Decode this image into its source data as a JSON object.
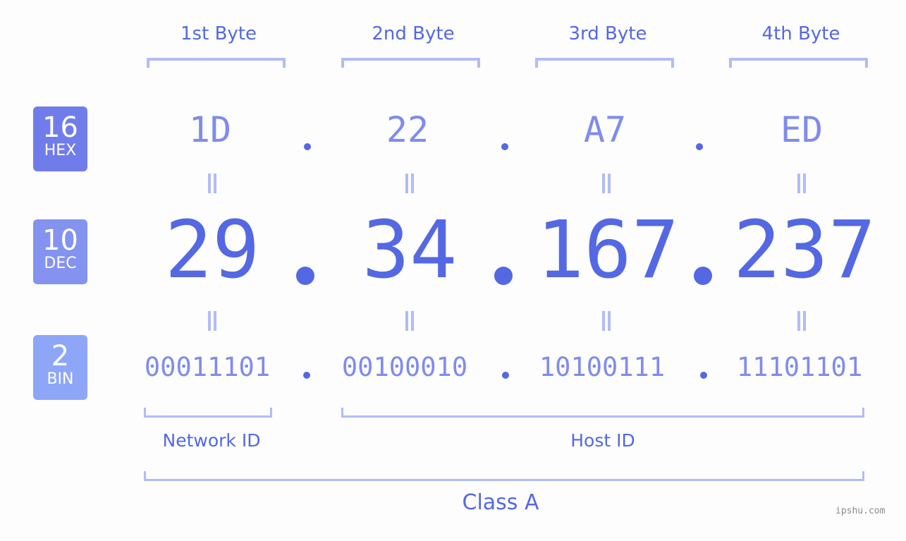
{
  "byte_headers": [
    "1st Byte",
    "2nd Byte",
    "3rd Byte",
    "4th Byte"
  ],
  "badges": {
    "hex": {
      "num": "16",
      "label": "HEX",
      "color": "#717ceb"
    },
    "dec": {
      "num": "10",
      "label": "DEC",
      "color": "#8492f0"
    },
    "bin": {
      "num": "2",
      "label": "BIN",
      "color": "#8ea6f7"
    }
  },
  "ip": {
    "hex": [
      "1D",
      "22",
      "A7",
      "ED"
    ],
    "dec": [
      "29",
      "34",
      "167",
      "237"
    ],
    "bin": [
      "00011101",
      "00100010",
      "10100111",
      "11101101"
    ],
    "separator": "."
  },
  "segments": {
    "network_label": "Network ID",
    "host_label": "Host ID",
    "class_label": "Class A"
  },
  "watermark": "ipshu.com",
  "colors": {
    "primary": "#5468e4",
    "secondary": "#7f8cec",
    "bracket": "#b1bcf6",
    "background": "#fcfdfc"
  }
}
